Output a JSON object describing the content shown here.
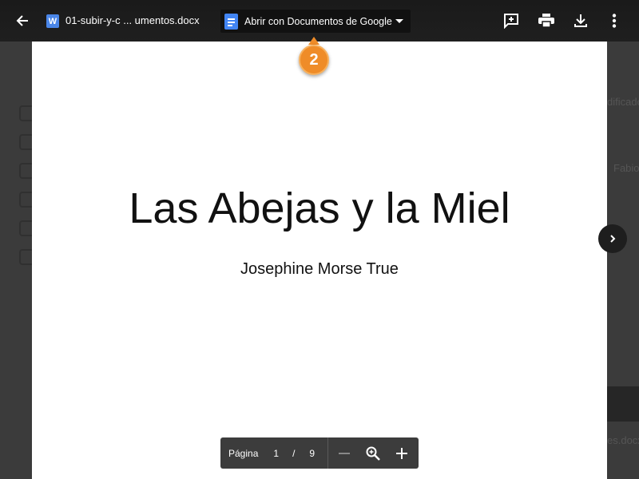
{
  "header": {
    "word_badge": "W",
    "file_name": "01-subir-y-c ... umentos.docx",
    "open_with_label": "Abrir con Documentos de Google"
  },
  "callout": {
    "number": "2"
  },
  "document": {
    "title": "Las Abejas y la Miel",
    "author": "Josephine Morse True"
  },
  "pager": {
    "label": "Página",
    "current": "1",
    "separator": "/",
    "total": "9"
  },
  "background": {
    "text_1": "dificado",
    "text_2": "Fabio",
    "text_3": "es.docx"
  },
  "colors": {
    "callout": "#ef8c28",
    "docs_blue": "#4285f4",
    "word_blue": "#4a86e8"
  }
}
